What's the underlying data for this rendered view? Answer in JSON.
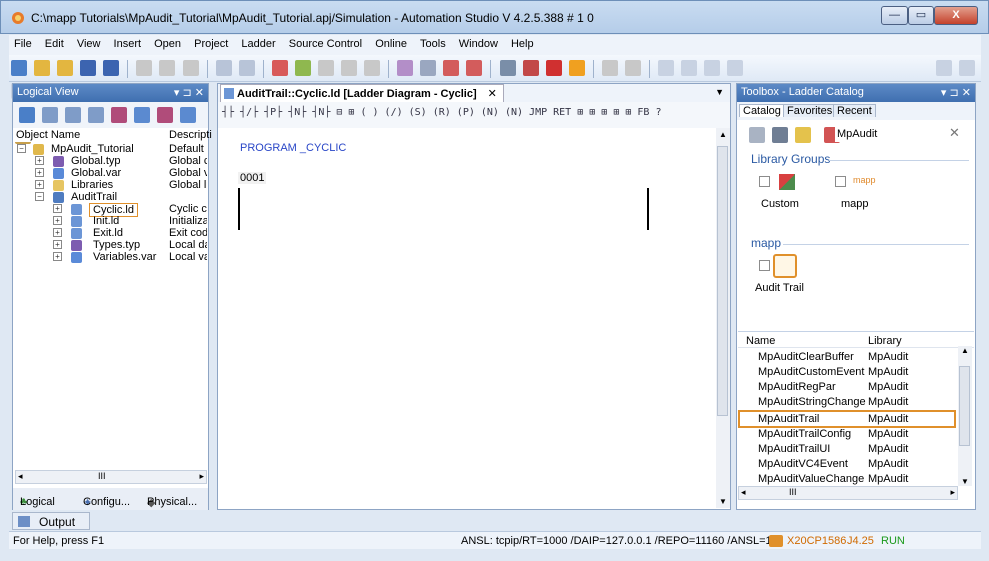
{
  "window": {
    "title": "C:\\mapp Tutorials\\MpAudit_Tutorial\\MpAudit_Tutorial.apj/Simulation - Automation Studio V 4.2.5.388 # 1 0",
    "min_icon": "minimize-icon",
    "max_icon": "maximize-icon",
    "close_label": "X"
  },
  "menu": [
    "File",
    "Edit",
    "View",
    "Insert",
    "Open",
    "Project",
    "Ladder",
    "Source Control",
    "Online",
    "Tools",
    "Window",
    "Help"
  ],
  "logical_view": {
    "title": "Logical View",
    "col_object": "Object Name",
    "col_desc": "Descripti",
    "tree": [
      {
        "name": "MpAudit_Tutorial",
        "desc": "Default p",
        "icon": "project-icon"
      },
      {
        "name": "Global.typ",
        "desc": "Global c",
        "icon": "types-icon"
      },
      {
        "name": "Global.var",
        "desc": "Global v",
        "icon": "variables-icon"
      },
      {
        "name": "Libraries",
        "desc": "Global li",
        "icon": "folder-icon"
      },
      {
        "name": "AuditTrail",
        "desc": "",
        "icon": "program-icon"
      },
      {
        "name": "Cyclic.ld",
        "desc": "Cyclic co",
        "icon": "ladder-file-icon"
      },
      {
        "name": "Init.ld",
        "desc": "Initializat",
        "icon": "ladder-file-icon"
      },
      {
        "name": "Exit.ld",
        "desc": "Exit code",
        "icon": "ladder-file-icon"
      },
      {
        "name": "Types.typ",
        "desc": "Local da",
        "icon": "types-icon"
      },
      {
        "name": "Variables.var",
        "desc": "Local va",
        "icon": "variables-icon"
      }
    ],
    "tabs": [
      "Logical ...",
      "Configu...",
      "Physical..."
    ],
    "scroll_mark": "III"
  },
  "editor": {
    "tab_title": "AuditTrail::Cyclic.ld [Ladder Diagram - Cyclic]",
    "program_label": "PROGRAM _CYCLIC",
    "rung_number": "0001",
    "ladder_toolbar": "┤├ ┤/├ ┤P├ ┤N├ ┤N├ ⊟ ⊞  ( ) (/) (S) (R) (P) (N) (N)  JMP RET  ⊞ ⊞ ⊞ ⊞ ⊞  FB ?"
  },
  "toolbox": {
    "title": "Toolbox - Ladder Catalog",
    "tabs": [
      "Catalog",
      "Favorites",
      "Recent"
    ],
    "search_value": "MpAudit",
    "library_groups_label": "Library Groups",
    "groups": [
      {
        "label": "Custom",
        "icon": "custom-blocks-icon"
      },
      {
        "label": "mapp",
        "icon": "mapp-icon"
      }
    ],
    "mapp_section_label": "mapp",
    "mapp_item": "Audit Trail",
    "table_headers": [
      "Name",
      "Library"
    ],
    "rows": [
      {
        "name": "MpAuditClearBuffer",
        "library": "MpAudit"
      },
      {
        "name": "MpAuditCustomEvent",
        "library": "MpAudit"
      },
      {
        "name": "MpAuditRegPar",
        "library": "MpAudit"
      },
      {
        "name": "MpAuditStringChange",
        "library": "MpAudit"
      },
      {
        "name": "MpAuditTrail",
        "library": "MpAudit"
      },
      {
        "name": "MpAuditTrailConfig",
        "library": "MpAudit"
      },
      {
        "name": "MpAuditTrailUI",
        "library": "MpAudit"
      },
      {
        "name": "MpAuditVC4Event",
        "library": "MpAudit"
      },
      {
        "name": "MpAuditValueChange",
        "library": "MpAudit"
      }
    ],
    "scroll_mark": "III"
  },
  "output_tab": "Output",
  "status": {
    "help": "For Help, press F1",
    "connection": "ANSL: tcpip/RT=1000 /DAIP=127.0.0.1 /REPO=11160 /ANSL=1",
    "cpu": "X20CP1586",
    "version": "J4.25",
    "state": "RUN"
  },
  "colors": {
    "highlight_border": "#e0902b",
    "accent_blue": "#2b5aa3",
    "status_green": "#1c9a1c",
    "status_orange": "#d06a00"
  }
}
